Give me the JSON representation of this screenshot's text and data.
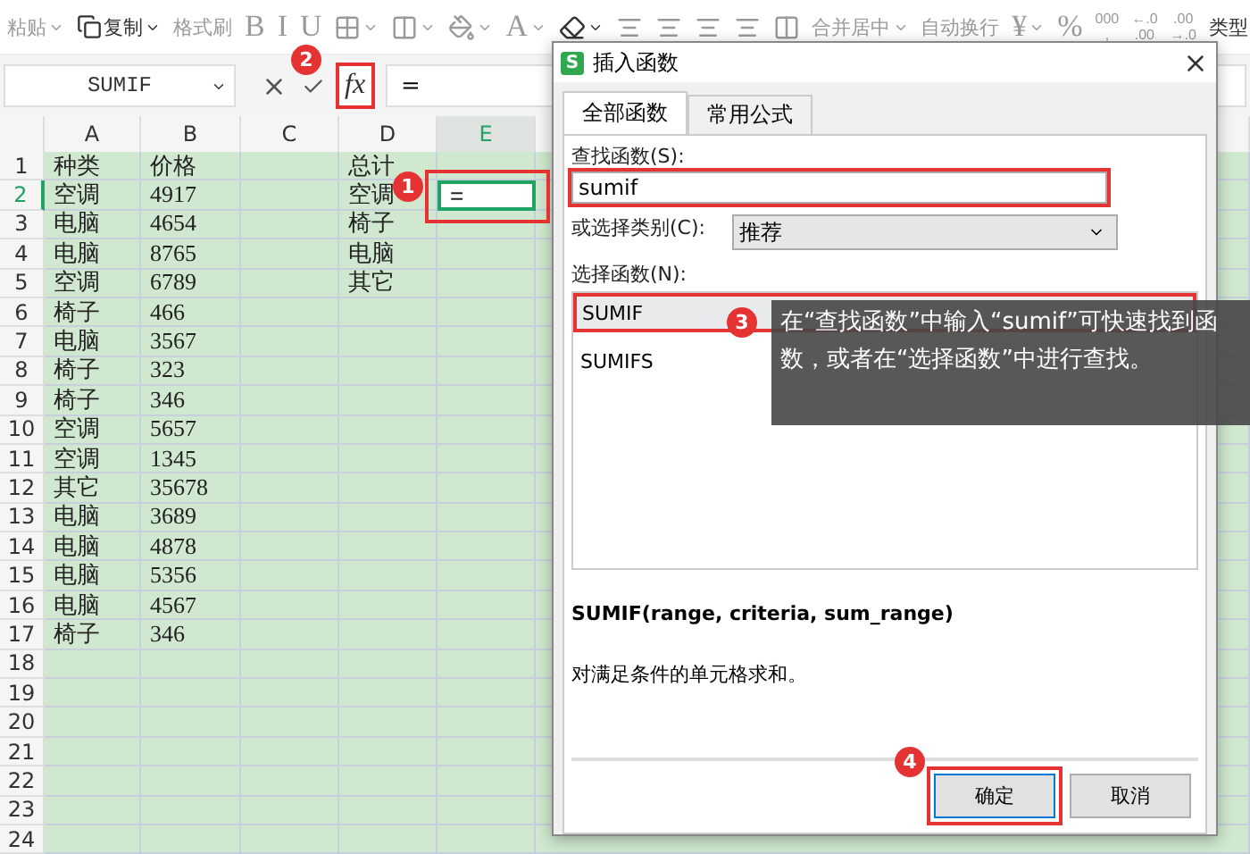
{
  "toolbar": {
    "items": [
      {
        "kind": "text",
        "label": "粘贴",
        "dropdown": true,
        "disabled": true
      },
      {
        "kind": "copy",
        "label": "复制",
        "dropdown": true,
        "disabled": false
      },
      {
        "kind": "text",
        "label": "格式刷",
        "dropdown": false,
        "disabled": true
      },
      {
        "kind": "glyph",
        "label": "B",
        "dropdown": false,
        "disabled": true
      },
      {
        "kind": "glyph",
        "label": "I",
        "dropdown": false,
        "disabled": true
      },
      {
        "kind": "glyph",
        "label": "U",
        "dropdown": false,
        "disabled": true
      },
      {
        "kind": "border",
        "dropdown": true,
        "disabled": true
      },
      {
        "kind": "shading",
        "dropdown": true,
        "disabled": true
      },
      {
        "kind": "fill",
        "dropdown": true,
        "disabled": true
      },
      {
        "kind": "glyph",
        "label": "A",
        "dropdown": true,
        "disabled": true
      },
      {
        "kind": "eraser",
        "dropdown": true,
        "disabled": false
      },
      {
        "kind": "align",
        "dropdown": false,
        "disabled": true
      },
      {
        "kind": "align",
        "dropdown": false,
        "disabled": true
      },
      {
        "kind": "align",
        "dropdown": false,
        "disabled": true
      },
      {
        "kind": "align",
        "dropdown": false,
        "disabled": true
      },
      {
        "kind": "wrap",
        "dropdown": false,
        "disabled": true
      },
      {
        "kind": "text",
        "label": "合并居中",
        "dropdown": true,
        "disabled": true
      },
      {
        "kind": "text",
        "label": "自动换行",
        "dropdown": false,
        "disabled": true
      },
      {
        "kind": "glyph",
        "label": "¥",
        "dropdown": true,
        "disabled": true
      },
      {
        "kind": "glyph",
        "label": "%",
        "dropdown": false,
        "disabled": true
      },
      {
        "kind": "stack",
        "label": "000",
        "label2": ",",
        "disabled": true
      },
      {
        "kind": "stack",
        "label": "←.0",
        "label2": ".00",
        "disabled": true
      },
      {
        "kind": "stack",
        "label": ".00",
        "label2": "→.0",
        "disabled": true
      },
      {
        "kind": "text",
        "label": "类型",
        "dropdown": false,
        "disabled": false
      }
    ]
  },
  "formula_bar": {
    "name_box": "SUMIF",
    "fx": "fx",
    "fx_highlighted": true,
    "formula": "="
  },
  "sheet": {
    "columns": [
      {
        "label": "A",
        "selected": false
      },
      {
        "label": "B",
        "selected": false
      },
      {
        "label": "C",
        "selected": false
      },
      {
        "label": "D",
        "selected": false
      },
      {
        "label": "E",
        "selected": true
      }
    ],
    "rows": [
      {
        "number": "1",
        "selected": false,
        "a": "种类",
        "b": "价格",
        "d": "总计"
      },
      {
        "number": "2",
        "selected": true,
        "a": "空调",
        "b": "4917",
        "d": "空调",
        "e": "=",
        "editing": true,
        "highlighted": true
      },
      {
        "number": "3",
        "selected": false,
        "a": "电脑",
        "b": "4654",
        "d": "椅子"
      },
      {
        "number": "4",
        "selected": false,
        "a": "电脑",
        "b": "8765",
        "d": "电脑"
      },
      {
        "number": "5",
        "selected": false,
        "a": "空调",
        "b": "6789",
        "d": "其它"
      },
      {
        "number": "6",
        "selected": false,
        "a": "椅子",
        "b": "466"
      },
      {
        "number": "7",
        "selected": false,
        "a": "电脑",
        "b": "3567"
      },
      {
        "number": "8",
        "selected": false,
        "a": "椅子",
        "b": "323"
      },
      {
        "number": "9",
        "selected": false,
        "a": "椅子",
        "b": "346"
      },
      {
        "number": "10",
        "selected": false,
        "a": "空调",
        "b": "5657"
      },
      {
        "number": "11",
        "selected": false,
        "a": "空调",
        "b": "1345"
      },
      {
        "number": "12",
        "selected": false,
        "a": "其它",
        "b": "35678"
      },
      {
        "number": "13",
        "selected": false,
        "a": "电脑",
        "b": "3689"
      },
      {
        "number": "14",
        "selected": false,
        "a": "电脑",
        "b": "4878"
      },
      {
        "number": "15",
        "selected": false,
        "a": "电脑",
        "b": "5356"
      },
      {
        "number": "16",
        "selected": false,
        "a": "电脑",
        "b": "4567"
      },
      {
        "number": "17",
        "selected": false,
        "a": "椅子",
        "b": "346"
      },
      {
        "number": "18",
        "selected": false
      },
      {
        "number": "19",
        "selected": false
      },
      {
        "number": "20",
        "selected": false
      },
      {
        "number": "21",
        "selected": false
      },
      {
        "number": "22",
        "selected": false
      },
      {
        "number": "23",
        "selected": false
      },
      {
        "number": "24",
        "selected": false
      }
    ]
  },
  "dialog": {
    "logo": "S",
    "title": "插入函数",
    "tabs": [
      {
        "label": "全部函数",
        "selected": true
      },
      {
        "label": "常用公式",
        "selected": false
      }
    ],
    "search_label": "查找函数(S):",
    "search": {
      "value": "sumif",
      "highlighted": true
    },
    "category_label": "或选择类别(C):",
    "category": "推荐",
    "list_label": "选择函数(N):",
    "functions": [
      {
        "name": "SUMIF",
        "selected": true,
        "highlighted": true
      },
      {
        "name": "SUMIFS",
        "selected": false,
        "highlighted": false
      }
    ],
    "signature": "SUMIF(range, criteria, sum_range)",
    "description": "对满足条件的单元格求和。",
    "buttons": [
      {
        "label": "确定",
        "primary": true,
        "highlighted": true
      },
      {
        "label": "取消",
        "primary": false,
        "highlighted": false
      }
    ]
  },
  "tooltip": "在“查找函数”中输入“sumif”可快速找到函数，或者在“选择函数”中进行查找。",
  "annotations": [
    {
      "number": "1"
    },
    {
      "number": "2"
    },
    {
      "number": "3"
    },
    {
      "number": "4"
    }
  ]
}
